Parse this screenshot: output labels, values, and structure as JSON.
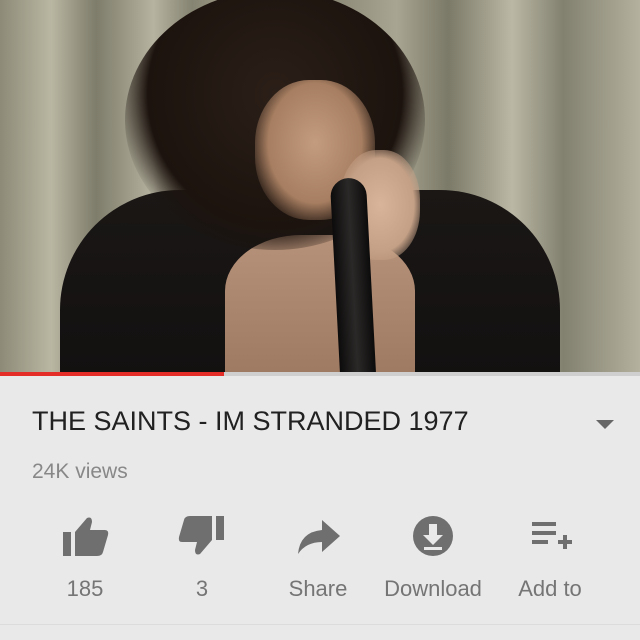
{
  "video": {
    "title": "THE SAINTS - IM STRANDED 1977",
    "views": "24K views",
    "progress_fraction": 0.35
  },
  "actions": [
    {
      "label": "185",
      "icon": "thumbs-up-icon"
    },
    {
      "label": "3",
      "icon": "thumbs-down-icon"
    },
    {
      "label": "Share",
      "icon": "share-arrow-icon"
    },
    {
      "label": "Download",
      "icon": "download-icon"
    },
    {
      "label": "Add to",
      "icon": "playlist-add-icon"
    }
  ],
  "colors": {
    "accent": "#e52d27",
    "icon": "#6f6f6f",
    "background": "#e9e9e9"
  }
}
